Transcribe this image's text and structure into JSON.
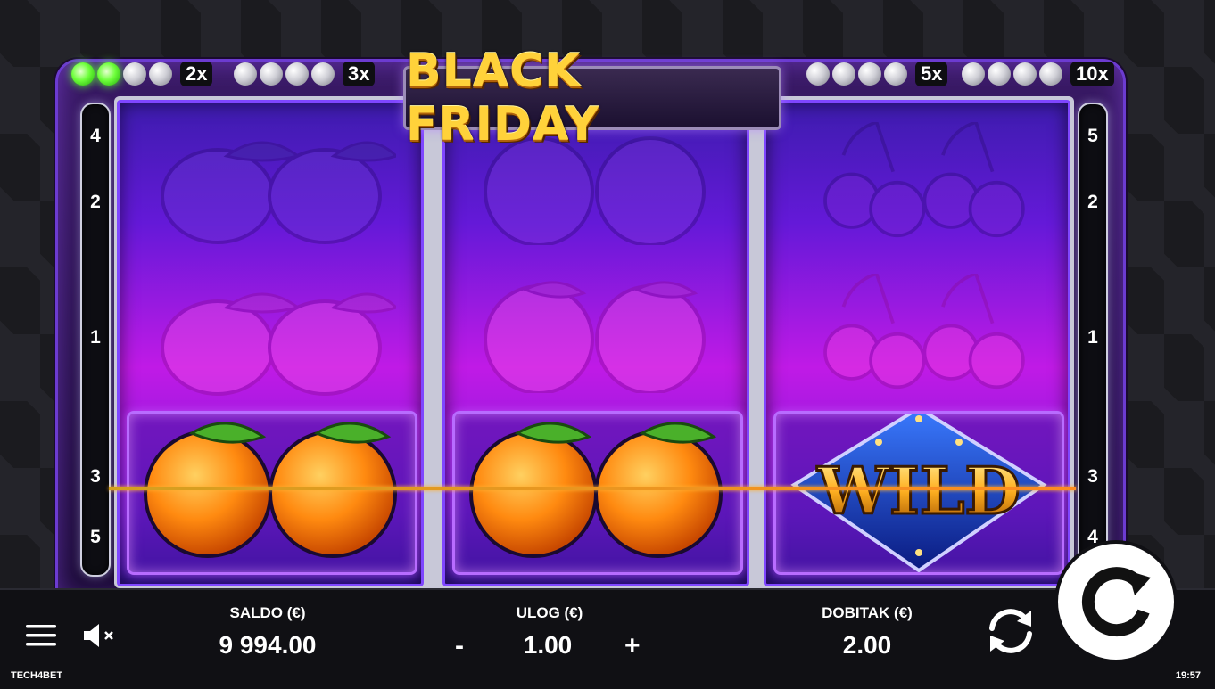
{
  "game": {
    "title": "BLACK FRIDAY",
    "provider": "TECH4BET",
    "clock": "19:57"
  },
  "multipliers": [
    {
      "label": "2x",
      "lit": 2,
      "total": 4
    },
    {
      "label": "3x",
      "lit": 0,
      "total": 4
    },
    {
      "label": "5x",
      "lit": 0,
      "total": 4
    },
    {
      "label": "10x",
      "lit": 0,
      "total": 4
    }
  ],
  "paylines": {
    "left": [
      "4",
      "2",
      "1",
      "3",
      "5"
    ],
    "right": [
      "5",
      "2",
      "1",
      "3",
      "4"
    ]
  },
  "reels": [
    {
      "symbols": [
        "lemon",
        "lemon",
        "orange"
      ],
      "highlight": "orange"
    },
    {
      "symbols": [
        "orange",
        "orange",
        "orange"
      ],
      "highlight": "orange"
    },
    {
      "symbols": [
        "cherry",
        "cherry",
        "wild"
      ],
      "highlight": "wild"
    }
  ],
  "wild_label": "WILD",
  "bottom_bar": {
    "balance_label": "SALDO (€)",
    "balance_value": "9 994.00",
    "bet_label": "ULOG (€)",
    "bet_value": "1.00",
    "bet_minus": "-",
    "bet_plus": "+",
    "win_label": "DOBITAK (€)",
    "win_value": "2.00"
  },
  "icons": {
    "menu": "hamburger-menu-icon",
    "sound": "speaker-muted-icon",
    "autoplay": "autoplay-arrows-icon",
    "spin": "spin-icon"
  },
  "colors": {
    "reel_top": "#3d1cae",
    "reel_mid": "#c01ae6",
    "win_frame": "#b86cff",
    "payline": "#d4a020",
    "title_gold": "#ffd23a",
    "multiplier_active": "#6dff3a"
  }
}
